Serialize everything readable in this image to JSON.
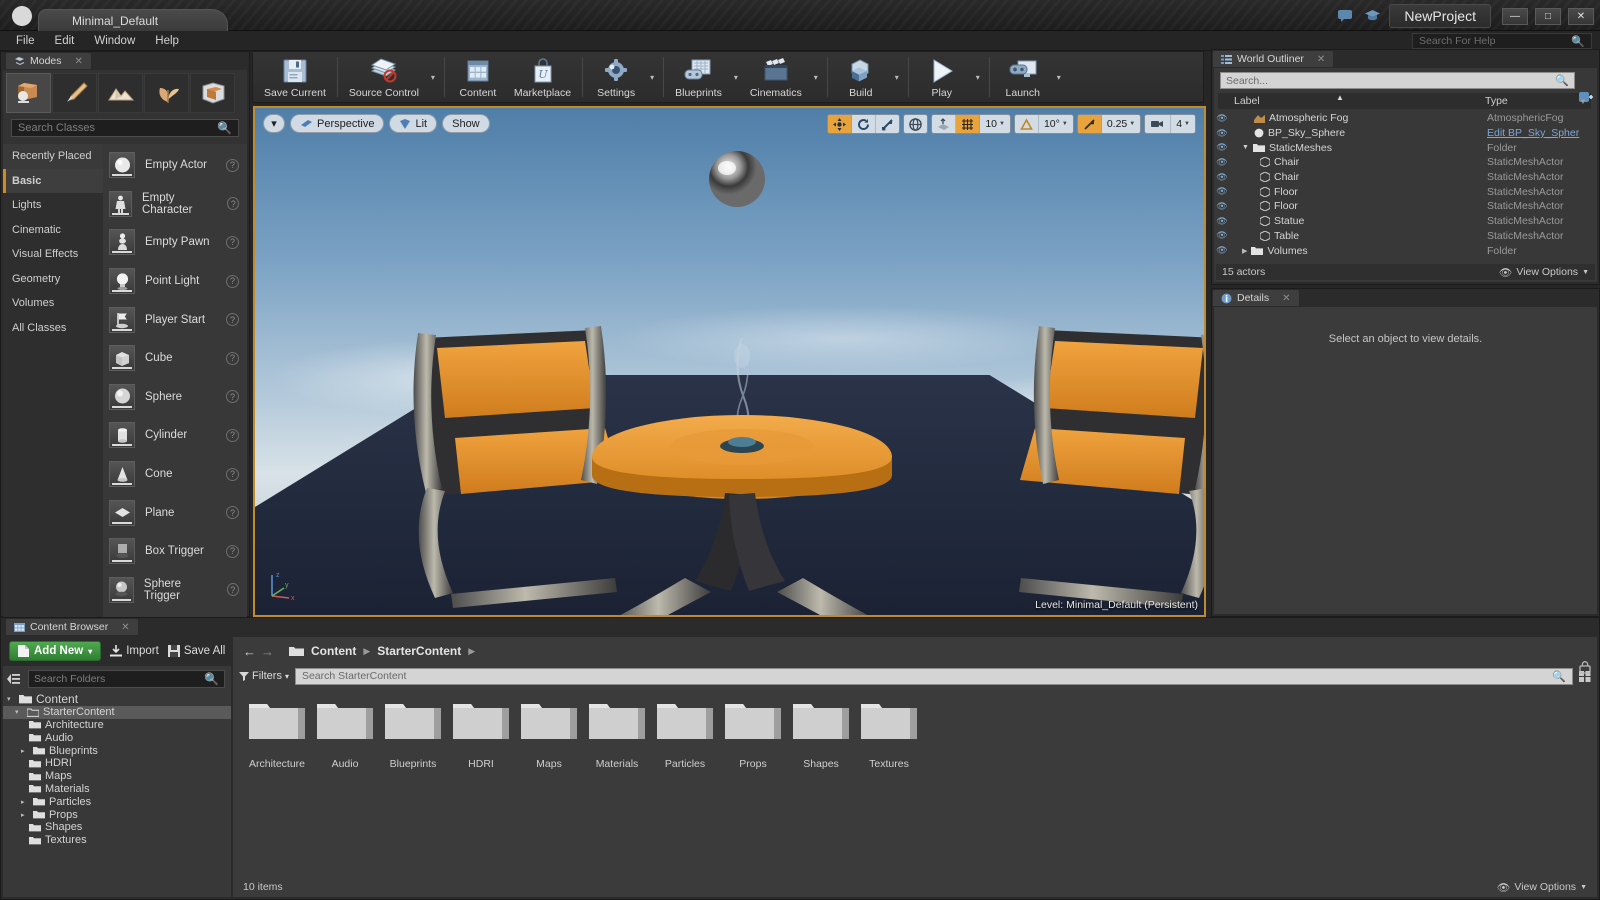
{
  "titlebar": {
    "project_tab": "Minimal_Default",
    "project_name": "NewProject",
    "minimize": "—",
    "maximize": "□",
    "close": "✕"
  },
  "menubar": {
    "items": [
      "File",
      "Edit",
      "Window",
      "Help"
    ],
    "help_search_placeholder": "Search For Help"
  },
  "toolbar": {
    "buttons": [
      {
        "label": "Save Current",
        "icon": "save-icon",
        "has_arrow": false
      },
      {
        "label": "Source Control",
        "icon": "source-control-icon",
        "has_arrow": true
      },
      {
        "label": "Content",
        "icon": "content-icon",
        "has_arrow": false
      },
      {
        "label": "Marketplace",
        "icon": "marketplace-icon",
        "has_arrow": false
      },
      {
        "label": "Settings",
        "icon": "settings-icon",
        "has_arrow": true
      },
      {
        "label": "Blueprints",
        "icon": "blueprints-icon",
        "has_arrow": true
      },
      {
        "label": "Cinematics",
        "icon": "cinematics-icon",
        "has_arrow": true
      },
      {
        "label": "Build",
        "icon": "build-icon",
        "has_arrow": true
      },
      {
        "label": "Play",
        "icon": "play-icon",
        "has_arrow": true
      },
      {
        "label": "Launch",
        "icon": "launch-icon",
        "has_arrow": true
      }
    ]
  },
  "modes": {
    "tab_title": "Modes",
    "close": "✕",
    "mode_icons": [
      "place-mode",
      "paint-mode",
      "landscape-mode",
      "foliage-mode",
      "geometry-edit-mode"
    ],
    "active_mode_index": 0,
    "search_placeholder": "Search Classes",
    "categories": [
      "Recently Placed",
      "Basic",
      "Lights",
      "Cinematic",
      "Visual Effects",
      "Geometry",
      "Volumes",
      "All Classes"
    ],
    "active_category": "Basic",
    "placeables": [
      {
        "label": "Empty Actor",
        "icon": "sphere-thumb"
      },
      {
        "label": "Empty Character",
        "icon": "character-thumb"
      },
      {
        "label": "Empty Pawn",
        "icon": "pawn-thumb"
      },
      {
        "label": "Point Light",
        "icon": "bulb-thumb"
      },
      {
        "label": "Player Start",
        "icon": "flag-thumb"
      },
      {
        "label": "Cube",
        "icon": "cube-thumb"
      },
      {
        "label": "Sphere",
        "icon": "sphere-thumb"
      },
      {
        "label": "Cylinder",
        "icon": "cylinder-thumb"
      },
      {
        "label": "Cone",
        "icon": "cone-thumb"
      },
      {
        "label": "Plane",
        "icon": "plane-thumb"
      },
      {
        "label": "Box Trigger",
        "icon": "box-trigger-thumb"
      },
      {
        "label": "Sphere Trigger",
        "icon": "sphere-trigger-thumb"
      }
    ],
    "help_glyph": "?"
  },
  "viewport": {
    "view_menu_arrow": "▾",
    "camera_mode": "Perspective",
    "view_mode": "Lit",
    "show_menu": "Show",
    "transform_tools": [
      "translate-icon",
      "rotate-icon",
      "scale-icon"
    ],
    "active_transform_index": 0,
    "coord_system": "world-axis-icon",
    "surface_snap": "surface-snap-icon",
    "grid_snap_enabled": true,
    "grid_snap_value": "10",
    "rotation_snap_value": "10°",
    "scale_snap_value": "0.25",
    "camera_speed_value": "4",
    "level_label_prefix": "Level:",
    "level_name": "Minimal_Default (Persistent)"
  },
  "outliner": {
    "tab_title": "World Outliner",
    "close": "✕",
    "search_placeholder": "Search...",
    "columns": [
      "Label",
      "Type"
    ],
    "sort_indicator": "▲",
    "rows": [
      {
        "label": "Atmospheric Fog",
        "type": "AtmosphericFog",
        "icon": "fog-icon",
        "indent": 1,
        "is_link": false
      },
      {
        "label": "BP_Sky_Sphere",
        "type": "Edit BP_Sky_Spher",
        "icon": "sphere-icon",
        "indent": 1,
        "is_link": true
      },
      {
        "label": "StaticMeshes",
        "type": "Folder",
        "icon": "folder-icon",
        "indent": 0,
        "is_link": false,
        "expanded": true
      },
      {
        "label": "Chair",
        "type": "StaticMeshActor",
        "icon": "mesh-icon",
        "indent": 1,
        "is_link": false
      },
      {
        "label": "Chair",
        "type": "StaticMeshActor",
        "icon": "mesh-icon",
        "indent": 1,
        "is_link": false
      },
      {
        "label": "Floor",
        "type": "StaticMeshActor",
        "icon": "mesh-icon",
        "indent": 1,
        "is_link": false
      },
      {
        "label": "Floor",
        "type": "StaticMeshActor",
        "icon": "mesh-icon",
        "indent": 1,
        "is_link": false
      },
      {
        "label": "Statue",
        "type": "StaticMeshActor",
        "icon": "mesh-icon",
        "indent": 1,
        "is_link": false
      },
      {
        "label": "Table",
        "type": "StaticMeshActor",
        "icon": "mesh-icon",
        "indent": 1,
        "is_link": false
      },
      {
        "label": "Volumes",
        "type": "Folder",
        "icon": "folder-icon",
        "indent": 0,
        "is_link": false,
        "expanded": false
      }
    ],
    "actor_count": "15 actors",
    "view_options": "View Options"
  },
  "details": {
    "tab_title": "Details",
    "close": "✕",
    "empty_message": "Select an object to view details."
  },
  "content_browser": {
    "tab_title": "Content Browser",
    "close": "✕",
    "add_new": "Add New",
    "add_new_arrow": "▾",
    "import": "Import",
    "save_all": "Save All",
    "folder_search_placeholder": "Search Folders",
    "breadcrumb": [
      "Content",
      "StarterContent"
    ],
    "breadcrumb_sep": "▶",
    "filters_label": "Filters",
    "asset_search_placeholder": "Search StarterContent",
    "tree": [
      {
        "label": "Content",
        "depth": 0,
        "expander": "▾",
        "selected": false
      },
      {
        "label": "StarterContent",
        "depth": 1,
        "expander": "▾",
        "selected": true
      },
      {
        "label": "Architecture",
        "depth": 2,
        "expander": "",
        "selected": false
      },
      {
        "label": "Audio",
        "depth": 2,
        "expander": "",
        "selected": false
      },
      {
        "label": "Blueprints",
        "depth": 2,
        "expander": "▸",
        "selected": false
      },
      {
        "label": "HDRI",
        "depth": 2,
        "expander": "",
        "selected": false
      },
      {
        "label": "Maps",
        "depth": 2,
        "expander": "",
        "selected": false
      },
      {
        "label": "Materials",
        "depth": 2,
        "expander": "",
        "selected": false
      },
      {
        "label": "Particles",
        "depth": 2,
        "expander": "▸",
        "selected": false
      },
      {
        "label": "Props",
        "depth": 2,
        "expander": "▸",
        "selected": false
      },
      {
        "label": "Shapes",
        "depth": 2,
        "expander": "",
        "selected": false
      },
      {
        "label": "Textures",
        "depth": 2,
        "expander": "",
        "selected": false
      }
    ],
    "assets": [
      "Architecture",
      "Audio",
      "Blueprints",
      "HDRI",
      "Maps",
      "Materials",
      "Particles",
      "Props",
      "Shapes",
      "Textures"
    ],
    "item_count": "10 items",
    "view_options": "View Options"
  },
  "colors": {
    "accent_orange": "#e8a33d",
    "viewport_border": "#c08a30",
    "add_new_green": "#3f9a42",
    "link_blue": "#7ea6d4",
    "panel_bg": "#2b2b2b"
  }
}
